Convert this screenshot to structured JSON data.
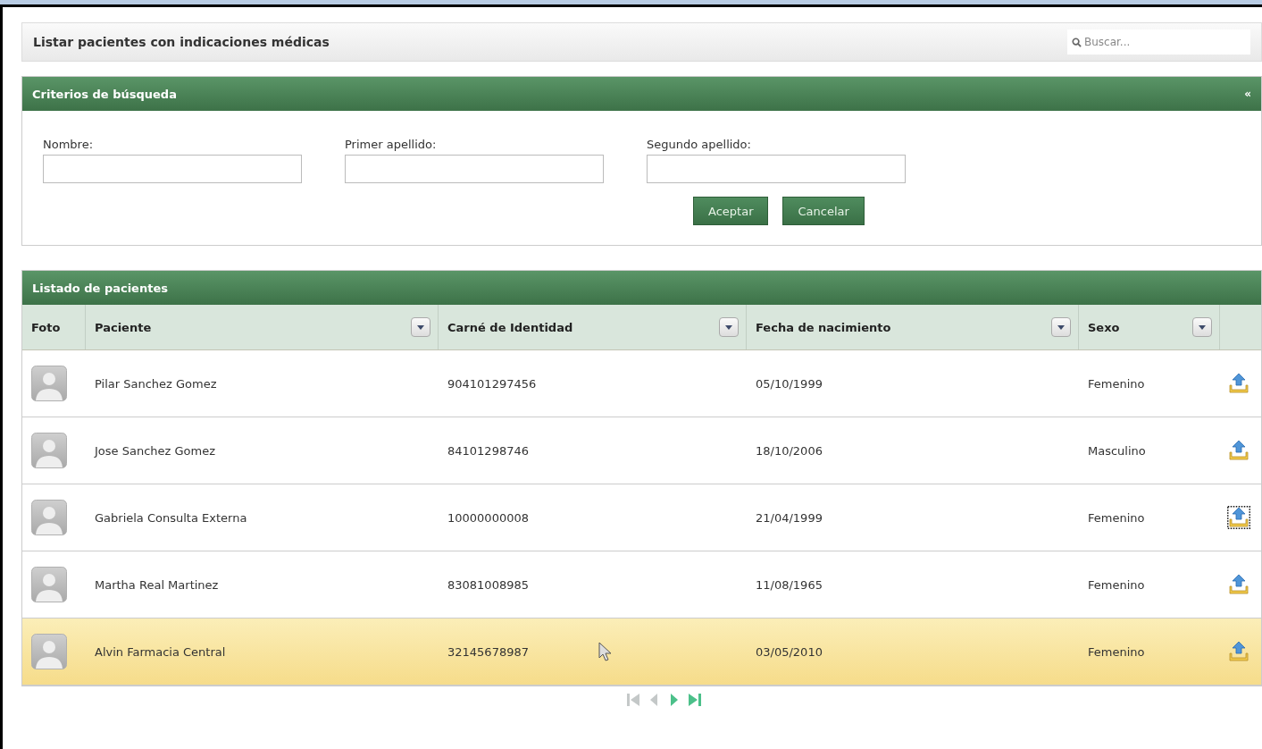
{
  "page_title": "Listar pacientes con indicaciones médicas",
  "search": {
    "placeholder": "Buscar..."
  },
  "criteria": {
    "title": "Criterios de búsqueda",
    "collapse": "«",
    "fields": [
      {
        "label": "Nombre:"
      },
      {
        "label": "Primer apellido:"
      },
      {
        "label": "Segundo apellido:"
      }
    ],
    "buttons": [
      "Aceptar",
      "Cancelar"
    ]
  },
  "patients": {
    "title": "Listado de pacientes",
    "columns": [
      {
        "label": "Foto",
        "menu": false
      },
      {
        "label": "Paciente",
        "menu": true
      },
      {
        "label": "Carné de Identidad",
        "menu": true
      },
      {
        "label": "Fecha de nacimiento",
        "menu": true
      },
      {
        "label": "Sexo",
        "menu": true
      }
    ],
    "rows": [
      {
        "name": "Pilar Sanchez Gomez",
        "id": "904101297456",
        "birth": "05/10/1999",
        "sex": "Femenino",
        "selected": false,
        "focused": false
      },
      {
        "name": "Jose Sanchez Gomez",
        "id": "84101298746",
        "birth": "18/10/2006",
        "sex": "Masculino",
        "selected": false,
        "focused": false
      },
      {
        "name": "Gabriela Consulta Externa",
        "id": "10000000008",
        "birth": "21/04/1999",
        "sex": "Femenino",
        "selected": false,
        "focused": true
      },
      {
        "name": "Martha Real Martinez",
        "id": "83081008985",
        "birth": "11/08/1965",
        "sex": "Femenino",
        "selected": false,
        "focused": false
      },
      {
        "name": "Alvin Farmacia Central",
        "id": "32145678987",
        "birth": "03/05/2010",
        "sex": "Femenino",
        "selected": true,
        "focused": false
      }
    ],
    "pager": [
      {
        "kind": "first",
        "disabled": true
      },
      {
        "kind": "prev",
        "disabled": true
      },
      {
        "kind": "next",
        "disabled": false
      },
      {
        "kind": "last",
        "disabled": false
      }
    ]
  }
}
